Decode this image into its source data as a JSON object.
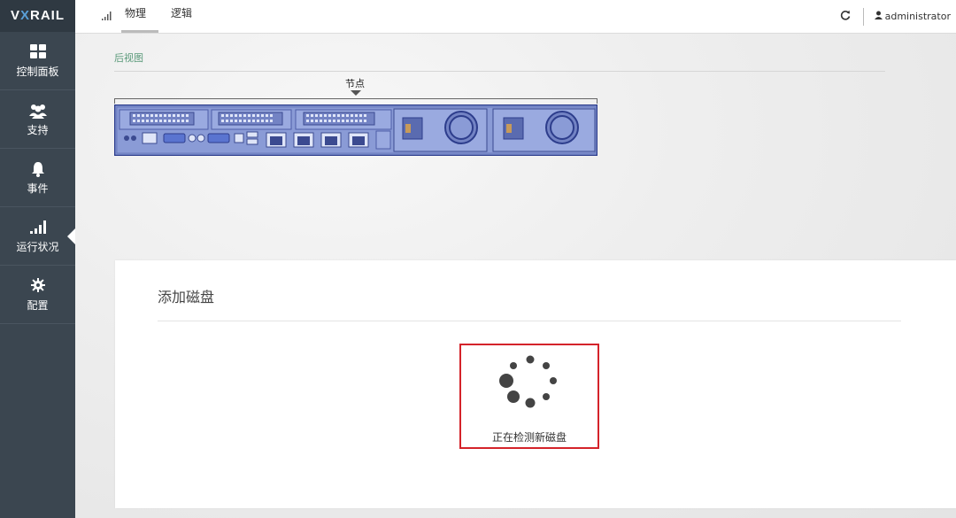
{
  "brand": {
    "logo_v": "V",
    "logo_x": "X",
    "logo_rest": "RAIL"
  },
  "sidebar": {
    "items": [
      {
        "label": "控制面板",
        "icon": "dashboard-grid-icon"
      },
      {
        "label": "支持",
        "icon": "users-icon"
      },
      {
        "label": "事件",
        "icon": "bell-icon"
      },
      {
        "label": "运行状况",
        "icon": "signal-bars-icon",
        "active": true
      },
      {
        "label": "配置",
        "icon": "gear-icon"
      }
    ]
  },
  "topbar": {
    "tabs": [
      {
        "label": "物理",
        "active": true
      },
      {
        "label": "逻辑",
        "active": false
      }
    ],
    "user": "administrator",
    "refresh_icon": "refresh-icon",
    "user_icon": "user-icon"
  },
  "main": {
    "breadcrumb": "后视图",
    "node_label": "节点"
  },
  "panel": {
    "title": "添加磁盘",
    "loading_text": "正在检测新磁盘"
  },
  "colors": {
    "sidebar_bg": "#3b4650",
    "accent_green": "#5a9a7a",
    "highlight_red": "#d4232a",
    "server_blue": "#6b7fc6"
  }
}
